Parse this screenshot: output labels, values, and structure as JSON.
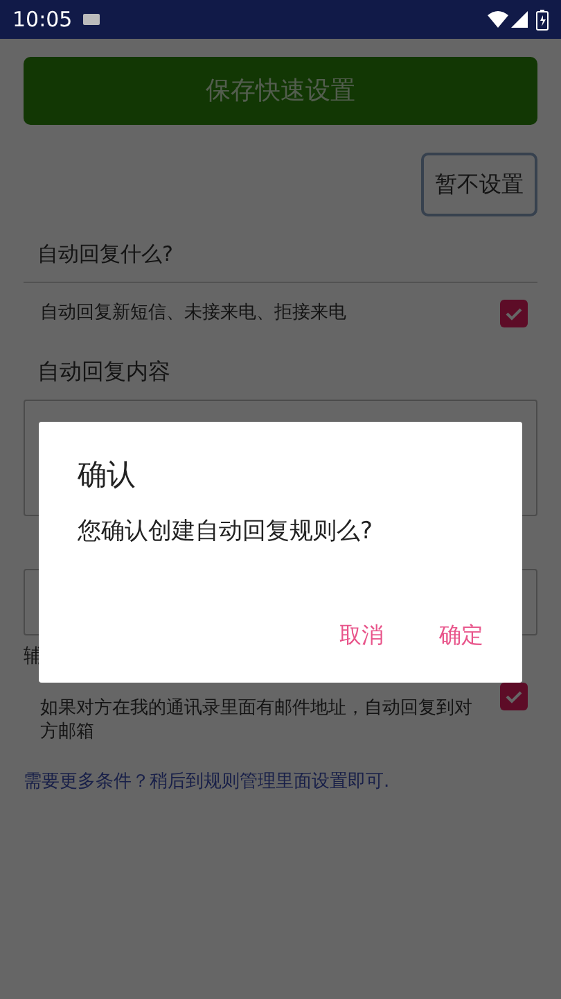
{
  "status_bar": {
    "time": "10:05"
  },
  "save_button": {
    "label": "保存快速设置"
  },
  "skip_button": {
    "label": "暂不设置"
  },
  "section_title": "自动回复什么?",
  "options": [
    {
      "label": "自动回复新短信、未接来电、拒接来电",
      "checked": true
    }
  ],
  "content_label": "自动回复内容",
  "helper_text": "辅",
  "email_option": {
    "label": "如果对方在我的通讯录里面有邮件地址，自动回复到对方邮箱",
    "checked": true
  },
  "more_link": "需要更多条件？稍后到规则管理里面设置即可.",
  "dialog": {
    "title": "确认",
    "message": "您确认创建自动回复规则么?",
    "buttons": [
      {
        "label": "取消"
      },
      {
        "label": "确定"
      }
    ]
  }
}
